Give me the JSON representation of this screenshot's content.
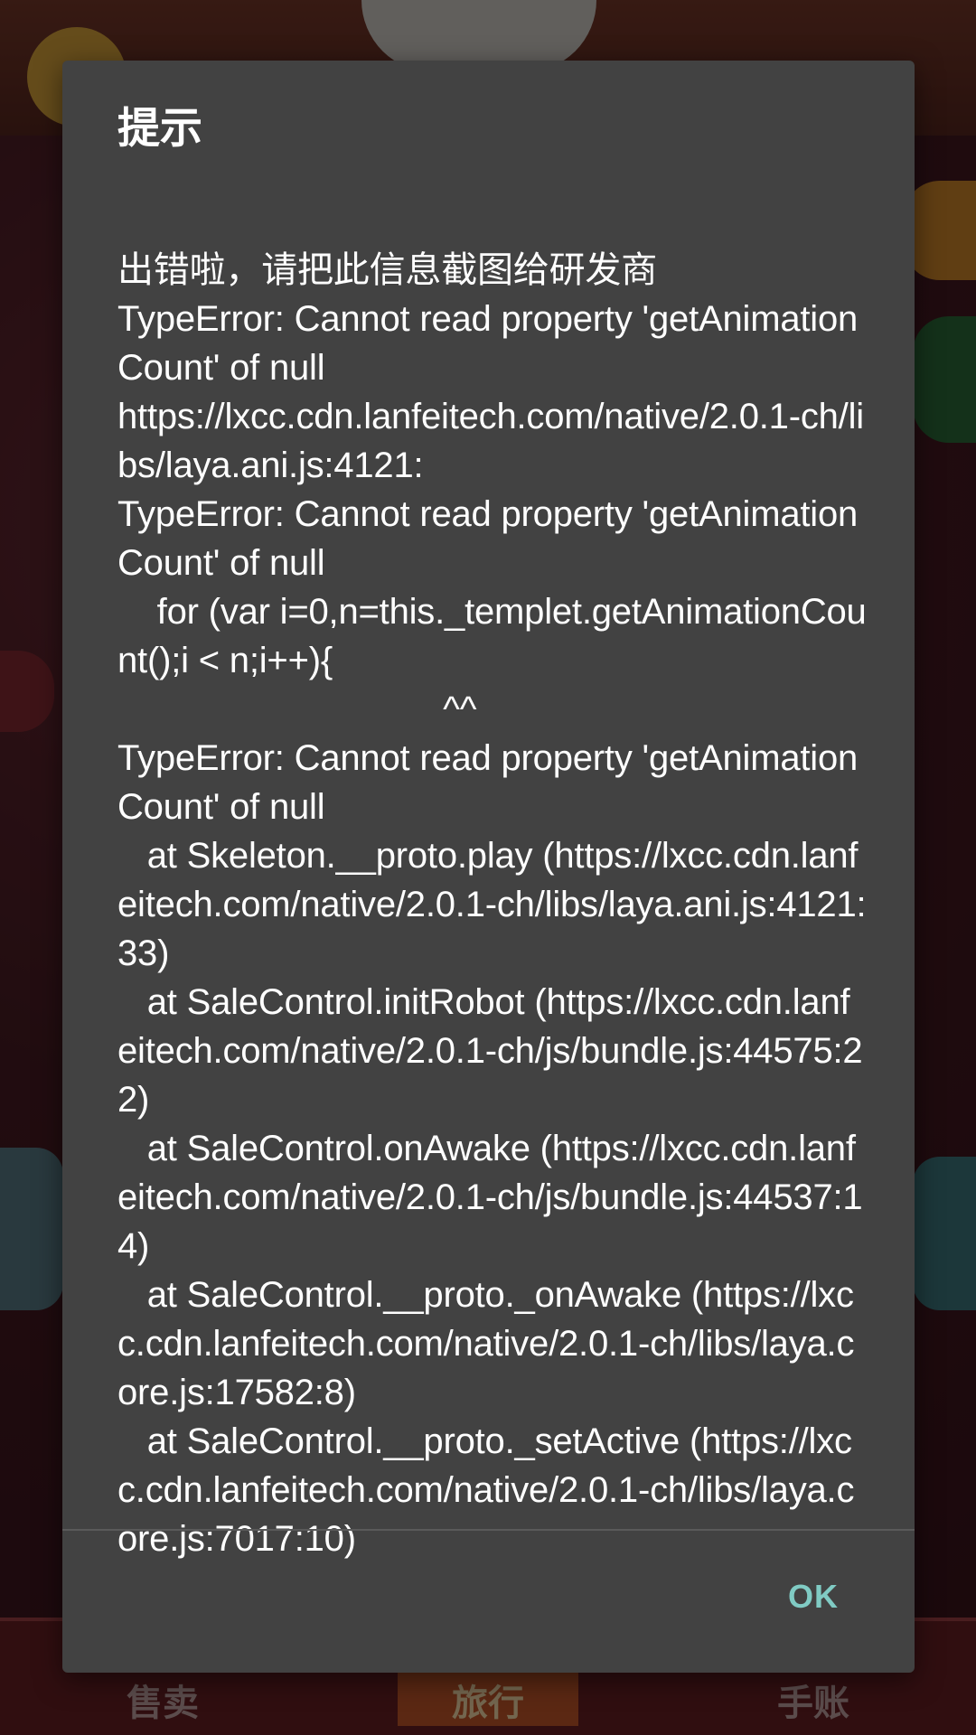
{
  "dialog": {
    "title": "提示",
    "message": "出错啦，请把此信息截图给研发商\nTypeError: Cannot read property 'getAnimationCount' of null\nhttps://lxcc.cdn.lanfeitech.com/native/2.0.1-ch/libs/laya.ani.js:4121:\nTypeError: Cannot read property 'getAnimationCount' of null\n    for (var i=0,n=this._templet.getAnimationCount();i < n;i++){\n                                 ^^\nTypeError: Cannot read property 'getAnimationCount' of null\n   at Skeleton.__proto.play (https://lxcc.cdn.lanfeitech.com/native/2.0.1-ch/libs/laya.ani.js:4121:33)\n   at SaleControl.initRobot (https://lxcc.cdn.lanfeitech.com/native/2.0.1-ch/js/bundle.js:44575:22)\n   at SaleControl.onAwake (https://lxcc.cdn.lanfeitech.com/native/2.0.1-ch/js/bundle.js:44537:14)\n   at SaleControl.__proto._onAwake (https://lxcc.cdn.lanfeitech.com/native/2.0.1-ch/libs/laya.core.js:17582:8)\n   at SaleControl.__proto._setActive (https://lxcc.cdn.lanfeitech.com/native/2.0.1-ch/libs/laya.core.js:7017:10)",
    "ok_label": "OK"
  },
  "background": {
    "nav_items": [
      "售卖",
      "旅行",
      "手账"
    ]
  },
  "colors": {
    "dialog_bg": "#424242",
    "accent": "#80cbc4",
    "title_text": "#ffffff"
  }
}
